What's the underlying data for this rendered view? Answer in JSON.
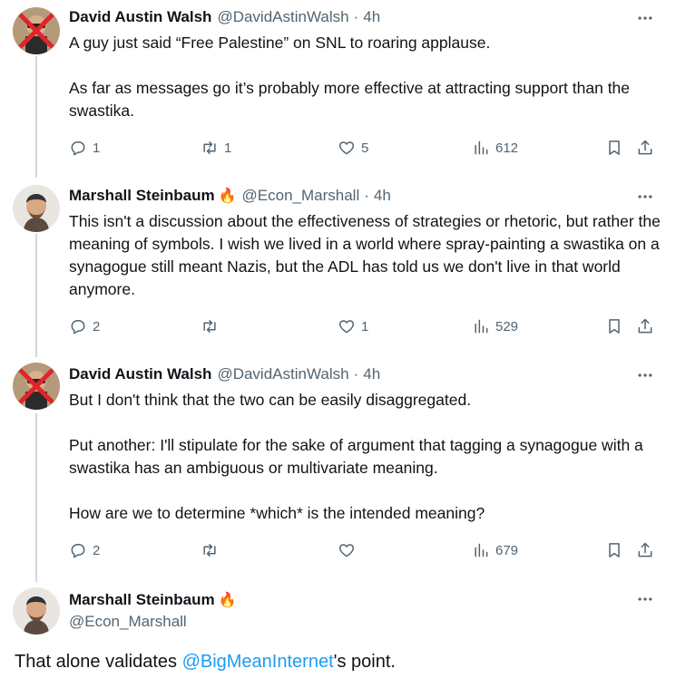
{
  "tweets": [
    {
      "name": "David Austin Walsh",
      "handle": "@DavidAstinWalsh",
      "time": "4h",
      "badge": "",
      "paragraphs": [
        "A guy just said “Free Palestine” on SNL to  roaring applause.",
        "As far as messages go it’s probably more effective at attracting support than the swastika."
      ],
      "replies": "1",
      "reposts": "1",
      "likes": "5",
      "views": "612"
    },
    {
      "name": "Marshall Steinbaum",
      "handle": "@Econ_Marshall",
      "time": "4h",
      "badge": "🔥",
      "paragraphs": [
        "This isn't a discussion about the effectiveness of strategies or rhetoric, but rather the meaning of symbols. I wish we lived in a world where spray-painting a swastika on a synagogue still meant Nazis, but the ADL has told us we don't live in that world anymore."
      ],
      "replies": "2",
      "reposts": "",
      "likes": "1",
      "views": "529"
    },
    {
      "name": "David Austin Walsh",
      "handle": "@DavidAstinWalsh",
      "time": "4h",
      "badge": "",
      "paragraphs": [
        "But I don't think that the two can be easily disaggregated.",
        "Put another: I'll stipulate for the sake of argument that tagging a synagogue with a swastika has an ambiguous or multivariate meaning.",
        "How are we to determine *which* is the intended meaning?"
      ],
      "replies": "2",
      "reposts": "",
      "likes": "",
      "views": "679"
    }
  ],
  "main": {
    "name": "Marshall Steinbaum",
    "badge": "🔥",
    "handle": "@Econ_Marshall",
    "text_before": "That alone validates ",
    "mention": "@BigMeanInternet",
    "text_after": "'s point."
  },
  "colors": {
    "text": "#0f1419",
    "secondary": "#536471",
    "link": "#1d9bf0",
    "thread_line": "#cfd9de"
  },
  "icons": {
    "reply": "reply-icon",
    "repost": "repost-icon",
    "like": "heart-icon",
    "views": "views-icon",
    "bookmark": "bookmark-icon",
    "share": "share-icon",
    "more": "more-icon"
  }
}
